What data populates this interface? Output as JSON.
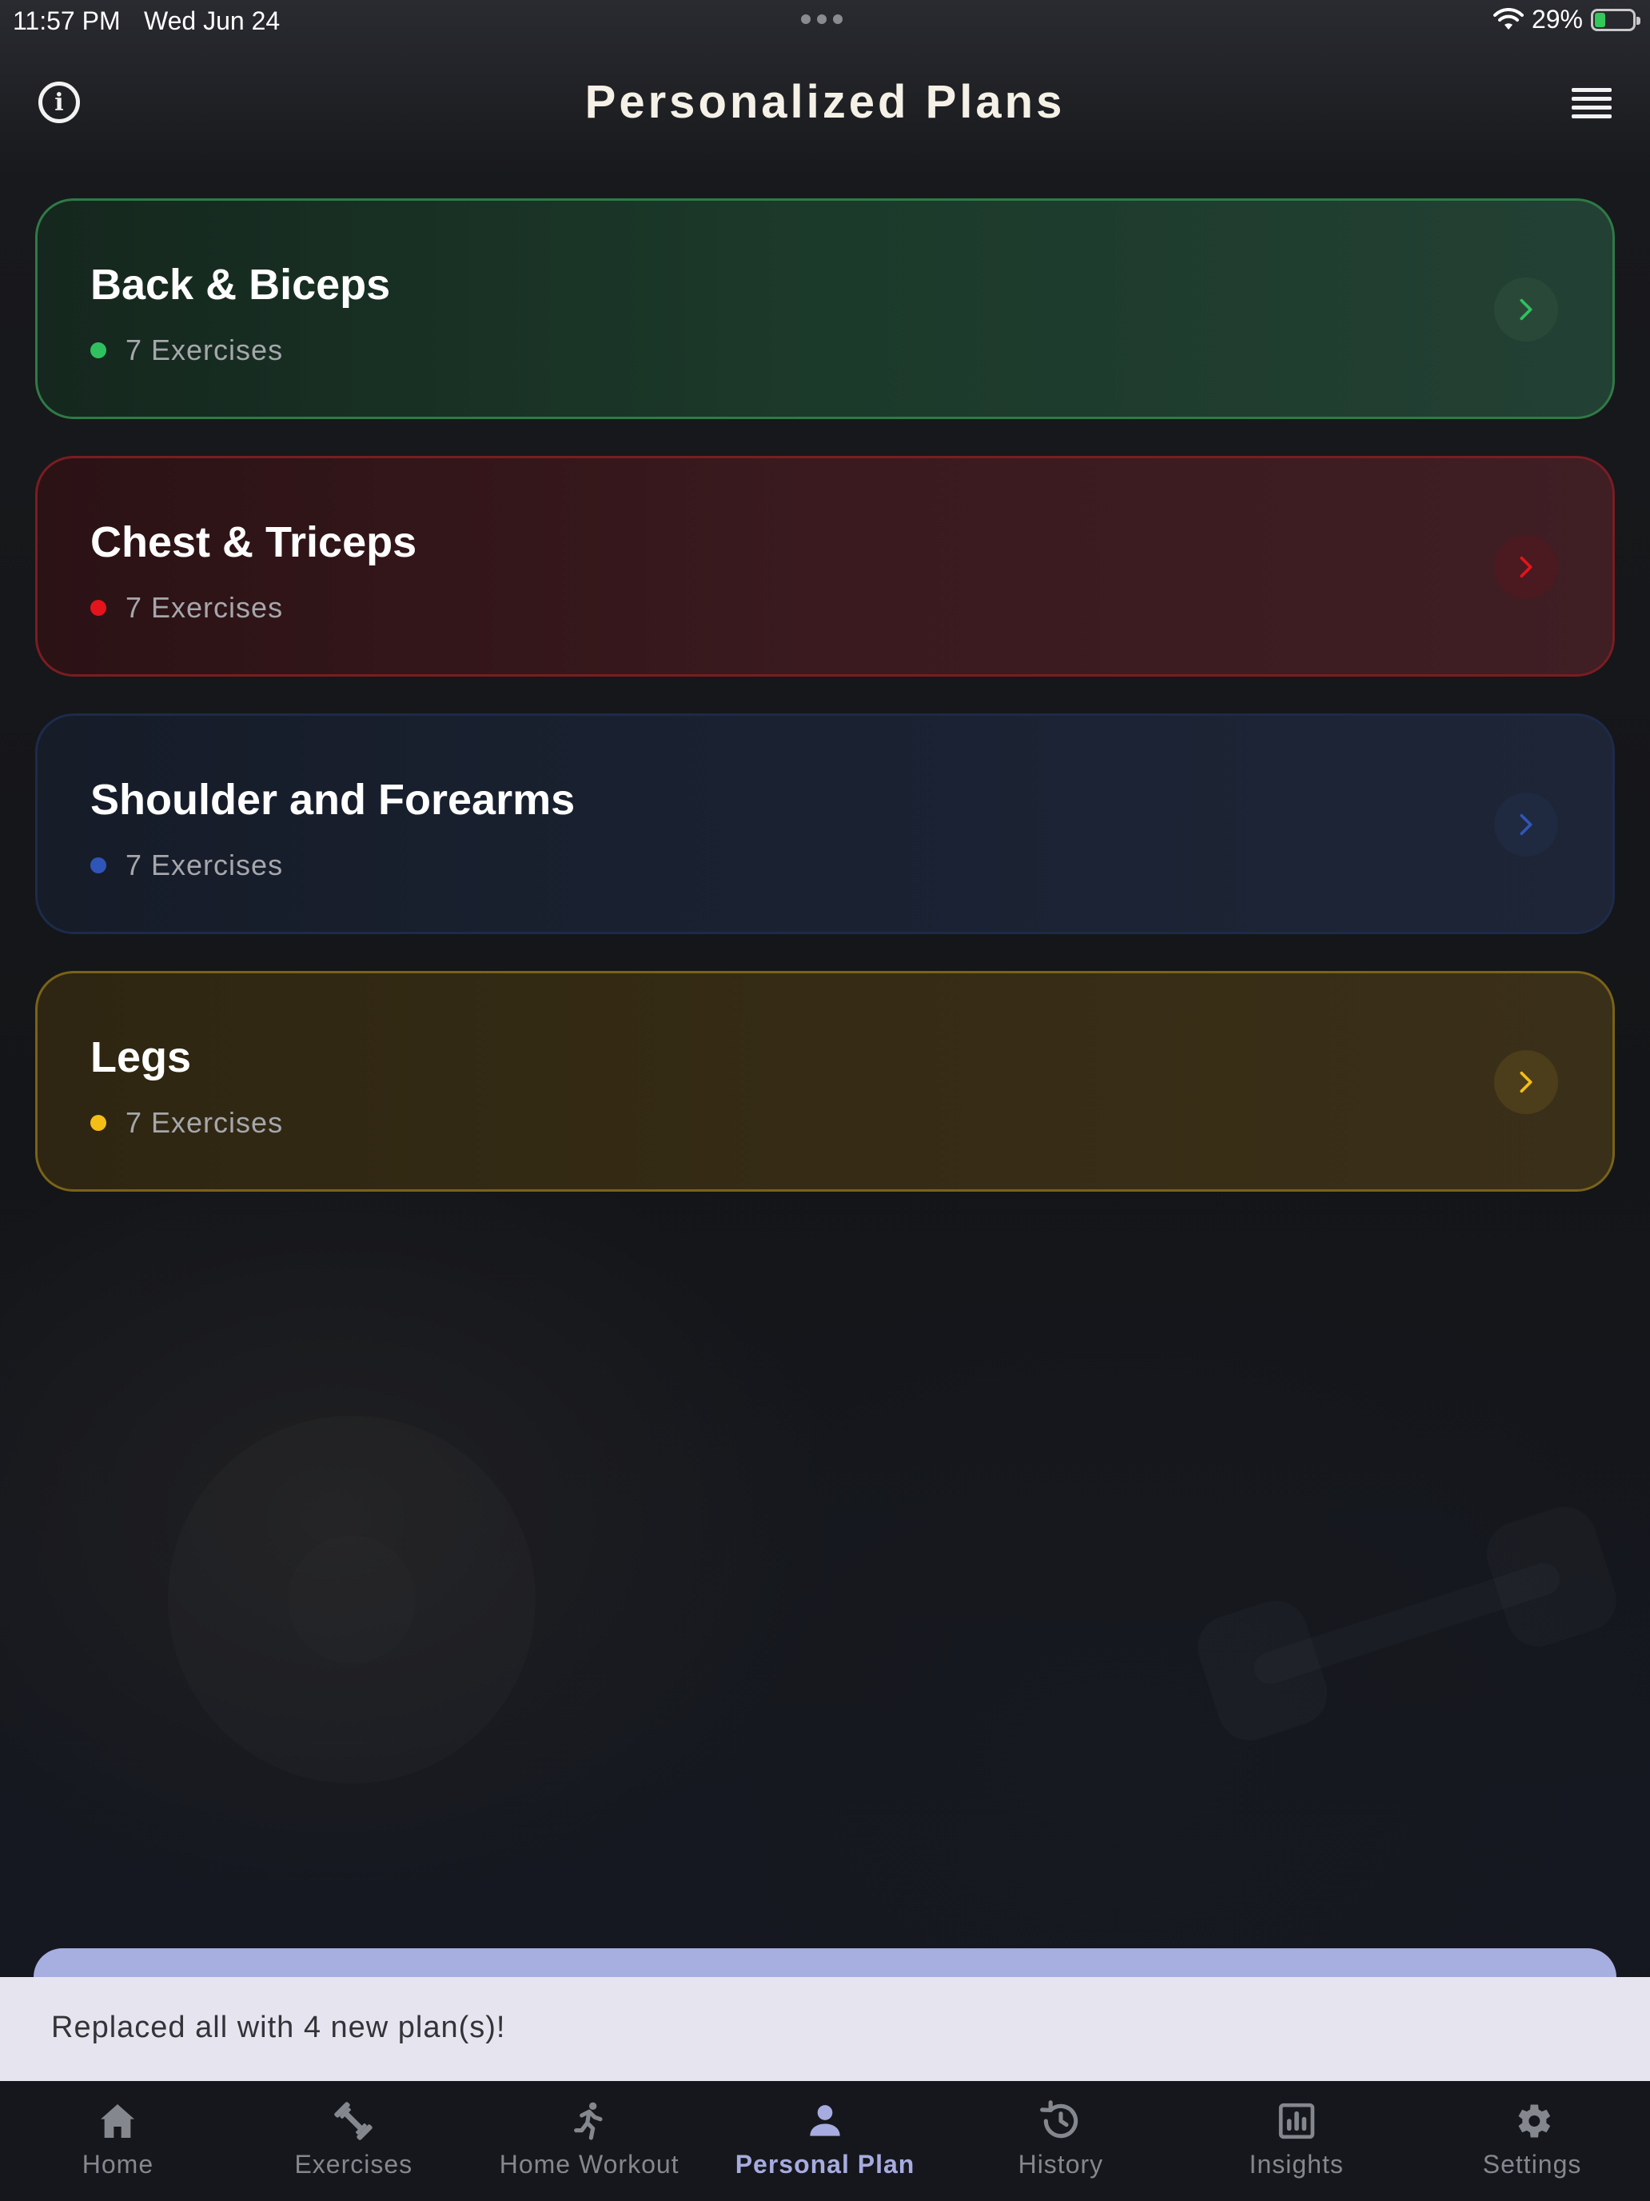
{
  "status_bar": {
    "time": "11:57 PM",
    "date": "Wed Jun 24",
    "battery": "29%",
    "battery_level": 0.29
  },
  "header": {
    "title": "Personalized Plans",
    "info_icon": "info-icon",
    "menu_icon": "list-icon"
  },
  "plans": [
    {
      "name": "Back & Biceps",
      "meta": "7 Exercises",
      "color": "#2fc160"
    },
    {
      "name": "Chest & Triceps",
      "meta": "7 Exercises",
      "color": "#e3141c"
    },
    {
      "name": "Shoulder and Forearms",
      "meta": "7 Exercises",
      "color": "#2f55b8"
    },
    {
      "name": "Legs",
      "meta": "7 Exercises",
      "color": "#f4be16"
    }
  ],
  "snackbar": {
    "message": "Replaced all with 4 new plan(s)!"
  },
  "bottom_nav": {
    "active": "Personal Plan",
    "accent_color": "#a6acdf",
    "items": [
      {
        "label": "Home",
        "icon": "home-icon"
      },
      {
        "label": "Exercises",
        "icon": "dumbbell-icon"
      },
      {
        "label": "Home Workout",
        "icon": "run-icon"
      },
      {
        "label": "Personal Plan",
        "icon": "person-icon"
      },
      {
        "label": "History",
        "icon": "history-icon"
      },
      {
        "label": "Insights",
        "icon": "chart-icon"
      },
      {
        "label": "Settings",
        "icon": "gear-icon"
      }
    ]
  }
}
